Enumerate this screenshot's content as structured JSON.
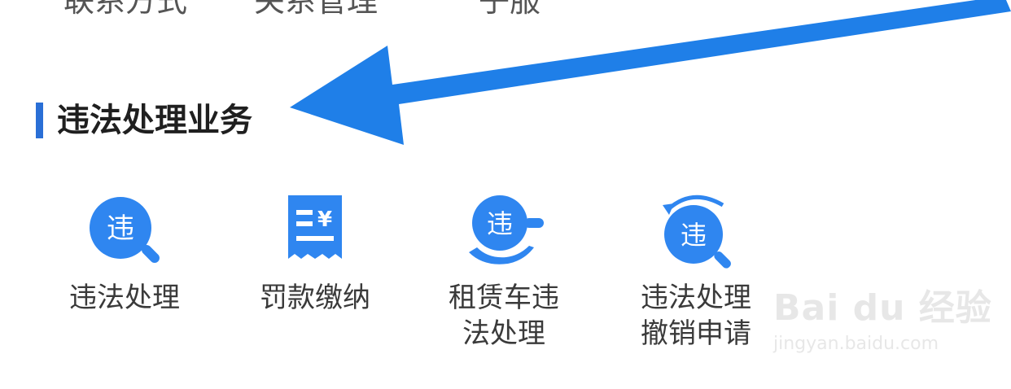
{
  "top_row_partial": [
    "联系方式",
    "关系管理",
    "子服"
  ],
  "section": {
    "title": "违法处理业务"
  },
  "services": [
    {
      "label": "违法处理",
      "icon": "magnifier-violation-icon",
      "glyph": "违"
    },
    {
      "label": "罚款缴纳",
      "icon": "receipt-yen-icon",
      "glyph": "¥"
    },
    {
      "label": "租赁车违\n法处理",
      "icon": "violation-hand-icon",
      "glyph": "违"
    },
    {
      "label": "违法处理\n撤销申请",
      "icon": "violation-revoke-icon",
      "glyph": "违"
    }
  ],
  "watermark": {
    "logo": "Bai du 经验",
    "url": "jingyan.baidu.com"
  },
  "colors": {
    "accent": "#2a6fd6",
    "icon_blue": "#2f86f0",
    "arrow": "#1f7fe8"
  }
}
